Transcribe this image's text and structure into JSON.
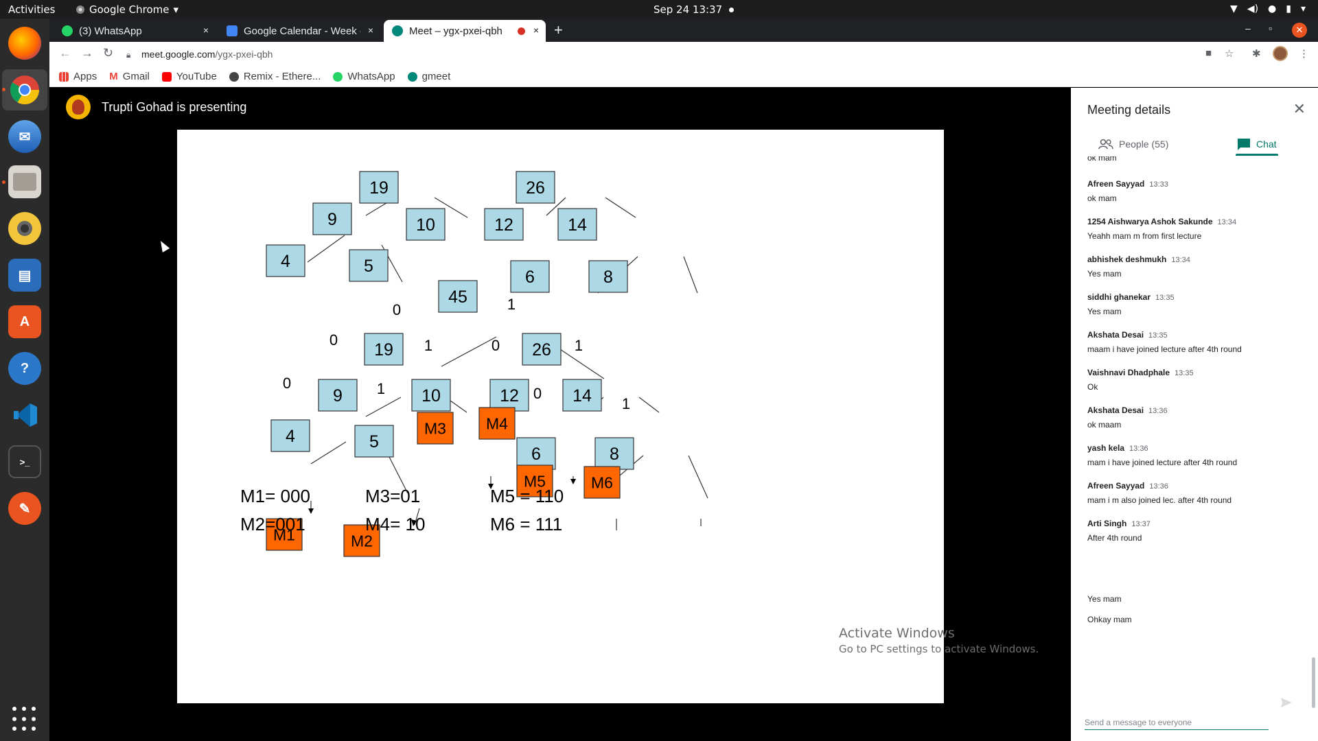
{
  "topbar": {
    "activities": "Activities",
    "app": "Google Chrome",
    "clock": "Sep 24  13:37"
  },
  "tabs": [
    {
      "title": "(3) WhatsApp",
      "close": "×"
    },
    {
      "title": "Google Calendar - Week o",
      "close": "×"
    },
    {
      "title": "Meet – ygx-pxei-qbh",
      "close": "×"
    }
  ],
  "address": {
    "domain": "meet.google.com",
    "path": "/ygx-pxei-qbh"
  },
  "bookmarks": [
    "Apps",
    "Gmail",
    "YouTube",
    "Remix - Ethere...",
    "WhatsApp",
    "gmeet"
  ],
  "presenter": {
    "text": "Trupti Gohad is presenting"
  },
  "slide": {
    "tree1": {
      "root": "19",
      "left": "9",
      "right": "10",
      "ll": "4",
      "lr": "5"
    },
    "tree2": {
      "root": "26",
      "left": "12",
      "right": "14",
      "rl": "6",
      "rr": "8"
    },
    "huffman": {
      "nodes": [
        "45",
        "19",
        "26",
        "9",
        "10",
        "12",
        "14",
        "4",
        "5",
        "6",
        "8"
      ],
      "leaves": [
        "M1",
        "M2",
        "M3",
        "M4",
        "M5",
        "M6"
      ],
      "edge_labels": [
        "0",
        "1",
        "0",
        "1",
        "0",
        "1",
        "0",
        "1",
        "0",
        "1"
      ]
    },
    "codes": [
      "M1= 000",
      "M2=001",
      "M3=01",
      "M4= 10",
      "M5 = 110",
      "M6 = 111"
    ],
    "colors": {
      "node": "#add8e6",
      "leaf": "#ff6600"
    }
  },
  "watermark": {
    "line1": "Activate Windows",
    "line2": "Go to PC settings to activate Windows."
  },
  "panel": {
    "title": "Meeting details",
    "tab_people": "People (55)",
    "tab_chat": "Chat",
    "cut_text": "ok mam",
    "messages": [
      {
        "sender": "Afreen Sayyad",
        "time": "13:33",
        "text": "ok mam"
      },
      {
        "sender": "1254 Aishwarya Ashok Sakunde",
        "time": "13:34",
        "text": "Yeahh mam m from first lecture"
      },
      {
        "sender": "abhishek deshmukh",
        "time": "13:34",
        "text": "Yes mam"
      },
      {
        "sender": "siddhi ghanekar",
        "time": "13:35",
        "text": "Yes mam"
      },
      {
        "sender": "Akshata Desai",
        "time": "13:35",
        "text": "maam i have joined lecture after 4th round"
      },
      {
        "sender": "Vaishnavi Dhadphale",
        "time": "13:35",
        "text": "Ok"
      },
      {
        "sender": "Akshata Desai",
        "time": "13:36",
        "text": "ok maam"
      },
      {
        "sender": "yash kela",
        "time": "13:36",
        "text": "mam i have joined lecture after 4th round"
      },
      {
        "sender": "Afreen Sayyad",
        "time": "13:36",
        "text": "mam i m also joined lec. after 4th round"
      },
      {
        "sender": "Arti Singh",
        "time": "13:37",
        "text": "After 4th round"
      }
    ],
    "extra": [
      "Yes mam",
      "Ohkay mam"
    ],
    "placeholder": "Send a message to everyone"
  }
}
